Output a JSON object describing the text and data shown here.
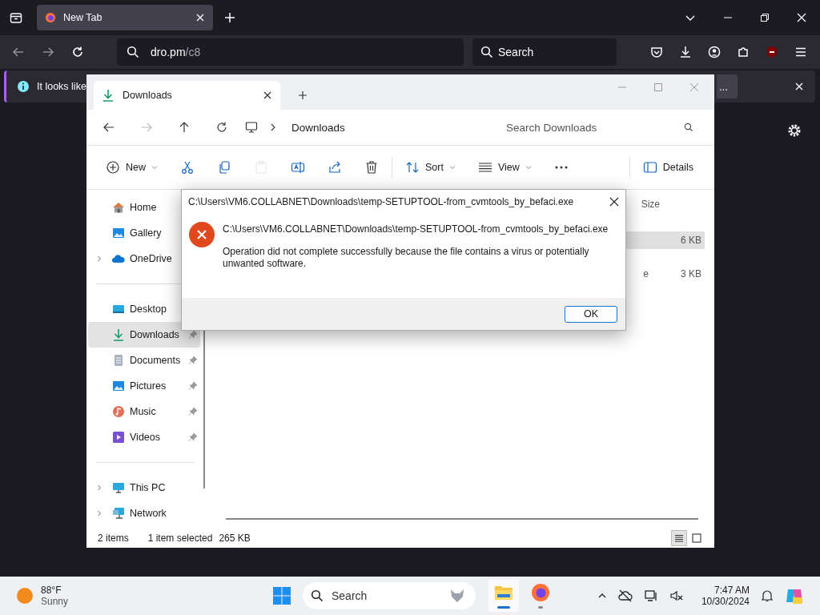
{
  "browser": {
    "tab": {
      "title": "New Tab",
      "selected": true
    },
    "url": {
      "host": "dro.pm",
      "path": "/c8"
    },
    "search": {
      "placeholder": "Search"
    },
    "notification": {
      "text": "It looks like",
      "button": "..."
    }
  },
  "explorer": {
    "tab": {
      "title": "Downloads"
    },
    "breadcrumb": "Downloads",
    "search": {
      "placeholder": "Search Downloads"
    },
    "toolbar": [
      {
        "kind": "new",
        "label": "New",
        "dropdown": true,
        "disabled": false
      },
      {
        "kind": "cut",
        "dropdown": false,
        "disabled": false
      },
      {
        "kind": "copy",
        "dropdown": false,
        "disabled": false
      },
      {
        "kind": "paste",
        "dropdown": false,
        "disabled": true
      },
      {
        "kind": "rename",
        "dropdown": false,
        "disabled": false
      },
      {
        "kind": "share",
        "dropdown": false,
        "disabled": false
      },
      {
        "kind": "delete",
        "dropdown": false,
        "disabled": false
      },
      {
        "kind": "sort",
        "label": "Sort",
        "dropdown": true,
        "disabled": false
      },
      {
        "kind": "view",
        "label": "View",
        "dropdown": true,
        "disabled": false
      },
      {
        "kind": "more",
        "dropdown": false,
        "disabled": false
      },
      {
        "kind": "details",
        "label": "Details",
        "dropdown": false,
        "disabled": false
      }
    ],
    "sidebar": {
      "groups": [
        [
          {
            "label": "Home",
            "kind": "home",
            "selected": false,
            "expandable": false
          },
          {
            "label": "Gallery",
            "kind": "gallery",
            "selected": false,
            "expandable": false
          },
          {
            "label": "OneDrive",
            "kind": "cloud",
            "selected": false,
            "expandable": true
          }
        ],
        [
          {
            "label": "Desktop",
            "kind": "desktop",
            "selected": false,
            "expandable": false
          },
          {
            "label": "Downloads",
            "kind": "download",
            "selected": true,
            "pinned": true,
            "expandable": false
          },
          {
            "label": "Documents",
            "kind": "document",
            "selected": false,
            "pinned": true,
            "expandable": false
          },
          {
            "label": "Pictures",
            "kind": "picture",
            "selected": false,
            "pinned": true,
            "expandable": false
          },
          {
            "label": "Music",
            "kind": "music",
            "selected": false,
            "pinned": true,
            "expandable": false
          },
          {
            "label": "Videos",
            "kind": "video",
            "selected": false,
            "pinned": true,
            "expandable": false
          }
        ],
        [
          {
            "label": "This PC",
            "kind": "pc",
            "selected": false,
            "pinned": false,
            "expandable": true
          },
          {
            "label": "Network",
            "kind": "network",
            "selected": false,
            "pinned": false,
            "expandable": true
          }
        ]
      ]
    },
    "files": {
      "columns": [
        {
          "label": "Size"
        }
      ],
      "rows": [
        {
          "size": "6 KB",
          "selected": true
        },
        {
          "column_3": "e",
          "size": "3 KB",
          "selected": false
        }
      ]
    },
    "status": {
      "count": "2 items",
      "selection": "1 item selected",
      "size": "265 KB"
    },
    "views": [
      {
        "kind": "details",
        "selected": true
      },
      {
        "kind": "tiles",
        "selected": false
      }
    ]
  },
  "dialog": {
    "title": "C:\\Users\\VM6.COLLABNET\\Downloads\\temp-SETUPTOOL-from_cvmtools_by_befaci.exe",
    "path": "C:\\Users\\VM6.COLLABNET\\Downloads\\temp-SETUPTOOL-from_cvmtools_by_befaci.exe",
    "message": "Operation did not complete successfully because the file contains a virus or potentially unwanted software.",
    "button": "OK"
  },
  "taskbar": {
    "weather": {
      "temperature": "88°F",
      "condition": "Sunny"
    },
    "search": {
      "placeholder": "Search"
    },
    "apps": [
      {
        "kind": "explorer",
        "active": true
      },
      {
        "kind": "firefox",
        "active": false
      }
    ],
    "time": "7:47 AM",
    "date": "10/30/2024"
  }
}
